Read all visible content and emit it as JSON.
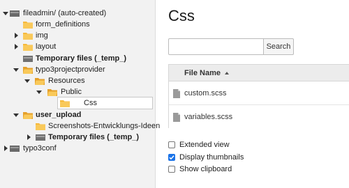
{
  "tree": {
    "items": [
      {
        "label": "fileadmin/ (auto-created)",
        "bold": false
      },
      {
        "label": "form_definitions",
        "bold": false
      },
      {
        "label": "img",
        "bold": false
      },
      {
        "label": "layout",
        "bold": false
      },
      {
        "label": "Temporary files (_temp_)",
        "bold": true
      },
      {
        "label": "typo3projectprovider",
        "bold": false
      },
      {
        "label": "Resources",
        "bold": false
      },
      {
        "label": "Public",
        "bold": false
      },
      {
        "label": "Css",
        "bold": false
      },
      {
        "label": "user_upload",
        "bold": true
      },
      {
        "label": "Screenshots-Entwicklungs-Ideen",
        "bold": false
      },
      {
        "label": "Temporary files (_temp_)",
        "bold": true
      },
      {
        "label": "typo3conf",
        "bold": false
      }
    ]
  },
  "main": {
    "title": "Css",
    "search": {
      "placeholder": "",
      "value": "",
      "button_label": "Search"
    },
    "table": {
      "header": "File Name",
      "rows": [
        "custom.scss",
        "variables.scss"
      ]
    },
    "options": [
      {
        "label": "Extended view",
        "checked": false
      },
      {
        "label": "Display thumbnails",
        "checked": true
      },
      {
        "label": "Show clipboard",
        "checked": false
      }
    ]
  },
  "colors": {
    "folder": "#f6b93b",
    "folder_dark": "#e5a02a",
    "storage": "#6a6a6a",
    "checkbox_accent": "#1a73e8"
  }
}
